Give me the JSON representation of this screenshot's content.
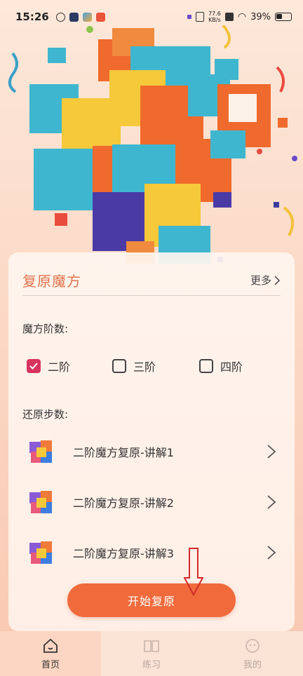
{
  "status_bar": {
    "time": "15:26",
    "net_speed_value": "77.6",
    "net_speed_unit": "KB/s",
    "battery": "39%"
  },
  "card": {
    "title": "复原魔方",
    "more_label": "更多",
    "order_label": "魔方阶数:",
    "options": [
      {
        "label": "二阶",
        "checked": true
      },
      {
        "label": "三阶",
        "checked": false
      },
      {
        "label": "四阶",
        "checked": false
      }
    ],
    "steps_label": "还原步数:",
    "items": [
      {
        "label": "二阶魔方复原-讲解1"
      },
      {
        "label": "二阶魔方复原-讲解2"
      },
      {
        "label": "二阶魔方复原-讲解3"
      }
    ],
    "start_button": "开始复原"
  },
  "bottom_nav": [
    {
      "label": "首页",
      "icon": "home-icon",
      "active": true
    },
    {
      "label": "练习",
      "icon": "book-icon",
      "active": false
    },
    {
      "label": "我的",
      "icon": "profile-icon",
      "active": false
    }
  ],
  "colors": {
    "accent": "#f06a3c",
    "title": "#e0724a",
    "checkbox_checked": "#d8335f"
  }
}
